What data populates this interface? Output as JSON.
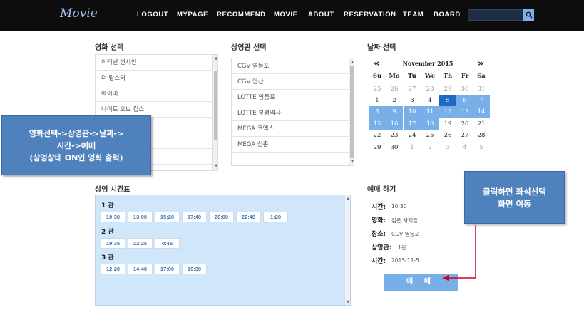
{
  "header": {
    "logo": "Movie",
    "nav": [
      "LOGOUT",
      "MYPAGE",
      "RECOMMEND",
      "MOVIE",
      "ABOUT",
      "RESERVATION",
      "TEAM",
      "BOARD"
    ],
    "search_placeholder": ""
  },
  "movie_select": {
    "title": "영화 선택",
    "items": [
      "이터널 선샤인",
      "더 랍스터",
      "에이미",
      "나이트 오브 컵스",
      "",
      "",
      ""
    ]
  },
  "theater_select": {
    "title": "상영관 선택",
    "items": [
      "CGV 영등포",
      "CGV 안산",
      "LOTTE 영등포",
      "LOTTE 부평역사",
      "MEGA 코엑스",
      "MEGA 신촌"
    ]
  },
  "date_select": {
    "title": "날짜 선택",
    "prev": "«",
    "next": "»",
    "month_label": "November 2015",
    "weekdays": [
      "Su",
      "Mo",
      "Tu",
      "We",
      "Th",
      "Fr",
      "Sa"
    ],
    "weeks": [
      [
        {
          "d": "25",
          "s": "other"
        },
        {
          "d": "26",
          "s": "other"
        },
        {
          "d": "27",
          "s": "other"
        },
        {
          "d": "28",
          "s": "other"
        },
        {
          "d": "29",
          "s": "other"
        },
        {
          "d": "30",
          "s": "other"
        },
        {
          "d": "31",
          "s": "other"
        }
      ],
      [
        {
          "d": "1",
          "s": "curr"
        },
        {
          "d": "2",
          "s": "curr"
        },
        {
          "d": "3",
          "s": "curr"
        },
        {
          "d": "4",
          "s": "curr"
        },
        {
          "d": "5",
          "s": "sel"
        },
        {
          "d": "6",
          "s": "avail"
        },
        {
          "d": "7",
          "s": "avail"
        }
      ],
      [
        {
          "d": "8",
          "s": "avail"
        },
        {
          "d": "9",
          "s": "avail"
        },
        {
          "d": "10",
          "s": "avail"
        },
        {
          "d": "11",
          "s": "avail"
        },
        {
          "d": "12",
          "s": "avail"
        },
        {
          "d": "13",
          "s": "avail"
        },
        {
          "d": "14",
          "s": "avail"
        }
      ],
      [
        {
          "d": "15",
          "s": "avail"
        },
        {
          "d": "16",
          "s": "avail"
        },
        {
          "d": "17",
          "s": "avail"
        },
        {
          "d": "18",
          "s": "avail"
        },
        {
          "d": "19",
          "s": "curr"
        },
        {
          "d": "20",
          "s": "curr"
        },
        {
          "d": "21",
          "s": "curr"
        }
      ],
      [
        {
          "d": "22",
          "s": "curr"
        },
        {
          "d": "23",
          "s": "curr"
        },
        {
          "d": "24",
          "s": "curr"
        },
        {
          "d": "25",
          "s": "curr"
        },
        {
          "d": "26",
          "s": "curr"
        },
        {
          "d": "27",
          "s": "curr"
        },
        {
          "d": "28",
          "s": "curr"
        }
      ],
      [
        {
          "d": "29",
          "s": "curr"
        },
        {
          "d": "30",
          "s": "curr"
        },
        {
          "d": "1",
          "s": "other"
        },
        {
          "d": "2",
          "s": "other"
        },
        {
          "d": "3",
          "s": "other"
        },
        {
          "d": "4",
          "s": "other"
        },
        {
          "d": "5",
          "s": "other"
        }
      ]
    ]
  },
  "schedule": {
    "title": "상영 시간표",
    "halls": [
      {
        "label": "1 관",
        "times": [
          "10:30",
          "13:00",
          "15:20",
          "17:40",
          "20:00",
          "22:40",
          "1:20"
        ]
      },
      {
        "label": "2 관",
        "times": [
          "19:35",
          "22:25",
          "0:45"
        ]
      },
      {
        "label": "3 관",
        "times": [
          "12:20",
          "14:40",
          "17:00",
          "19:30"
        ]
      }
    ]
  },
  "booking": {
    "title": "예매 하기",
    "rows": [
      {
        "label": "시간:",
        "value": "10:30"
      },
      {
        "label": "영화:",
        "value": "검은 사제들"
      },
      {
        "label": "장소:",
        "value": "CGV 영등포"
      },
      {
        "label": "상영관:",
        "value": "1관"
      },
      {
        "label": "시간:",
        "value": "2015-11-5"
      }
    ],
    "button": "예 매"
  },
  "annotations": {
    "left": [
      "영화선택->상영관->날짜->",
      "시간->예매",
      "(상영상태 ON인 영화 출력)"
    ],
    "right": [
      "클릭하면 좌석선택",
      "화면 이동"
    ]
  },
  "colors": {
    "accent": "#78afe8",
    "selected": "#1f6bc4",
    "schedule_bg": "#cfe6fb",
    "annotation": "#4f81bd",
    "arrow": "#d0021b"
  }
}
